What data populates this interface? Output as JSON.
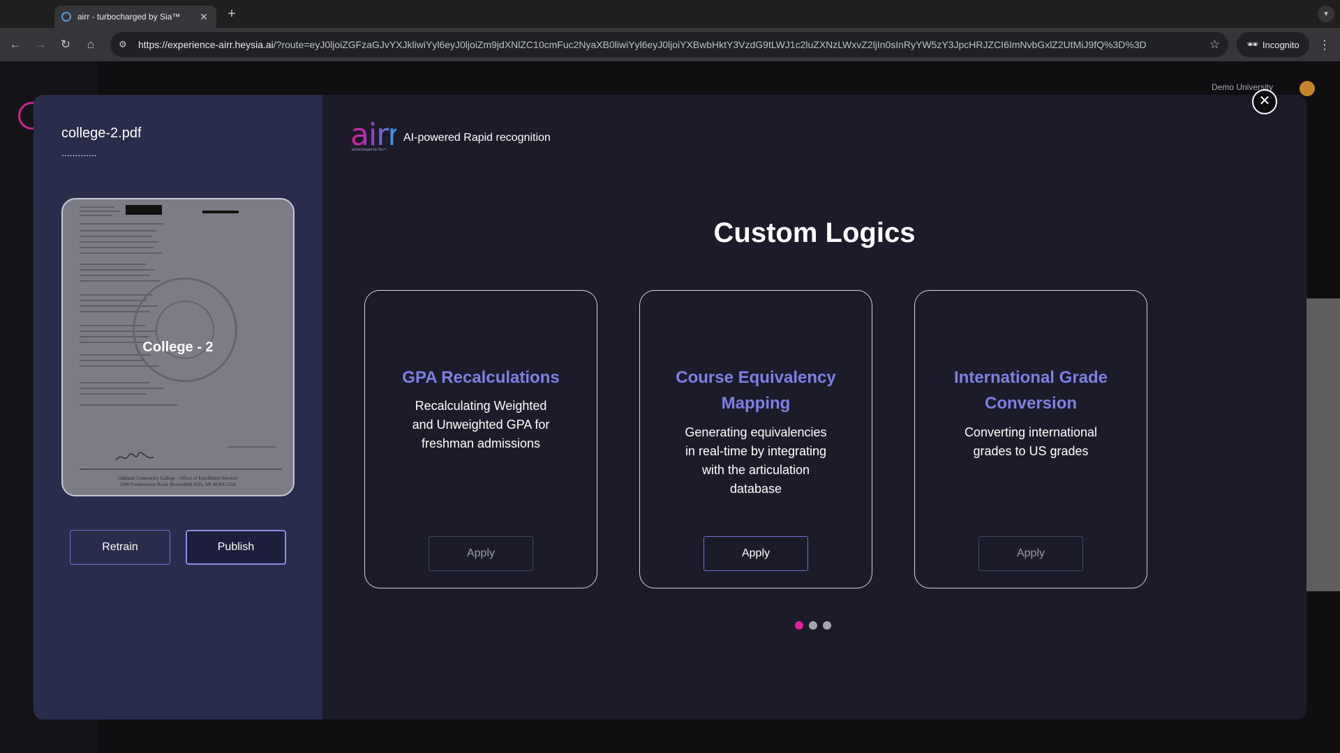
{
  "browser": {
    "tab_title": "airr - turbocharged by Sia™",
    "tab_close": "✕",
    "new_tab": "+",
    "url_host": "https://experience-airr.heysia.ai",
    "url_rest": "/?route=eyJ0ljoiZGFzaGJvYXJkliwiYyl6eyJ0ljoiZm9jdXNlZC10cmFuc2NyaXB0liwiYyl6eyJ0ljoiYXBwbHktY3VzdG9tLWJ1c2luZXNzLWxvZ2ljIn0sInRyYW5zY3JpcHRJZCI6ImNvbGxlZ2UtMiJ9fQ%3D%3D",
    "incognito_label": "Incognito"
  },
  "page": {
    "university": "Demo University"
  },
  "left_panel": {
    "file_name": "college-2.pdf",
    "file_dots": ".............",
    "preview_title": "College - 2",
    "preview_footer_line1": "Oakland Community College - Office of Enrollment Services",
    "preview_footer_line2": "2900 Featherstone Road, Bloomfield Hills, MI 48304-2266",
    "retrain_label": "Retrain",
    "publish_label": "Publish"
  },
  "brand": {
    "logo_text": "airr",
    "logo_sub": "turbocharged by Sia™",
    "tagline": "AI-powered Rapid recognition"
  },
  "main": {
    "title": "Custom Logics",
    "close_label": "✕",
    "cards": [
      {
        "title_line1": "GPA Recalculations",
        "title_line2": "",
        "desc_line1": "Recalculating Weighted",
        "desc_line2": "and Unweighted GPA for",
        "desc_line3": "freshman admissions",
        "desc_line4": "",
        "apply_label": "Apply"
      },
      {
        "title_line1": "Course Equivalency",
        "title_line2": "Mapping",
        "desc_line1": "Generating equivalencies",
        "desc_line2": "in real-time by integrating",
        "desc_line3": "with the articulation",
        "desc_line4": "database",
        "apply_label": "Apply"
      },
      {
        "title_line1": "International Grade",
        "title_line2": "Conversion",
        "desc_line1": "Converting international",
        "desc_line2": "grades to US grades",
        "desc_line3": "",
        "desc_line4": "",
        "apply_label": "Apply"
      }
    ],
    "carousel_active_index": 0,
    "carousel_count": 3
  },
  "colors": {
    "accent": "#7d80e3",
    "pink": "#e21f9b",
    "panel": "#2a2c4b",
    "modal": "#1c1b2a"
  }
}
